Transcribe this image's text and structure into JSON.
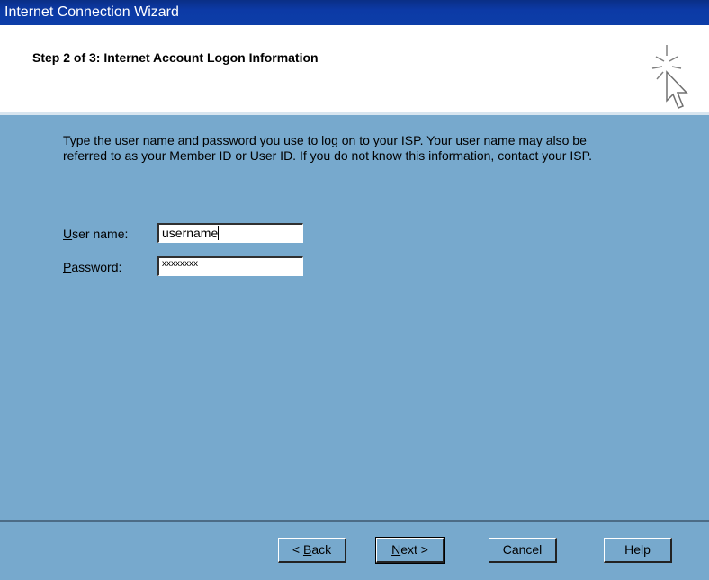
{
  "window": {
    "title": "Internet Connection Wizard"
  },
  "header": {
    "title": "Step 2 of 3: Internet Account Logon Information",
    "icon": "wizard-cursor-icon"
  },
  "instructions": "Type the user name and password you use to log on to your ISP. Your user name may also be referred to as your Member ID or User ID. If you do not know this information, contact your ISP.",
  "fields": {
    "username": {
      "label_mnemonic": "U",
      "label_rest": "ser name:",
      "value": "username"
    },
    "password": {
      "label_mnemonic": "P",
      "label_rest": "assword:",
      "value": "xxxxxxxx"
    }
  },
  "buttons": {
    "back": {
      "prefix": "< ",
      "mnemonic": "B",
      "rest": "ack"
    },
    "next": {
      "mnemonic": "N",
      "rest": "ext >"
    },
    "cancel": {
      "label": "Cancel"
    },
    "help": {
      "label": "Help"
    }
  },
  "colors": {
    "dialog_bg": "#77a9cd",
    "title_bar": "#0d3ea8",
    "header_bg": "#ffffff"
  }
}
